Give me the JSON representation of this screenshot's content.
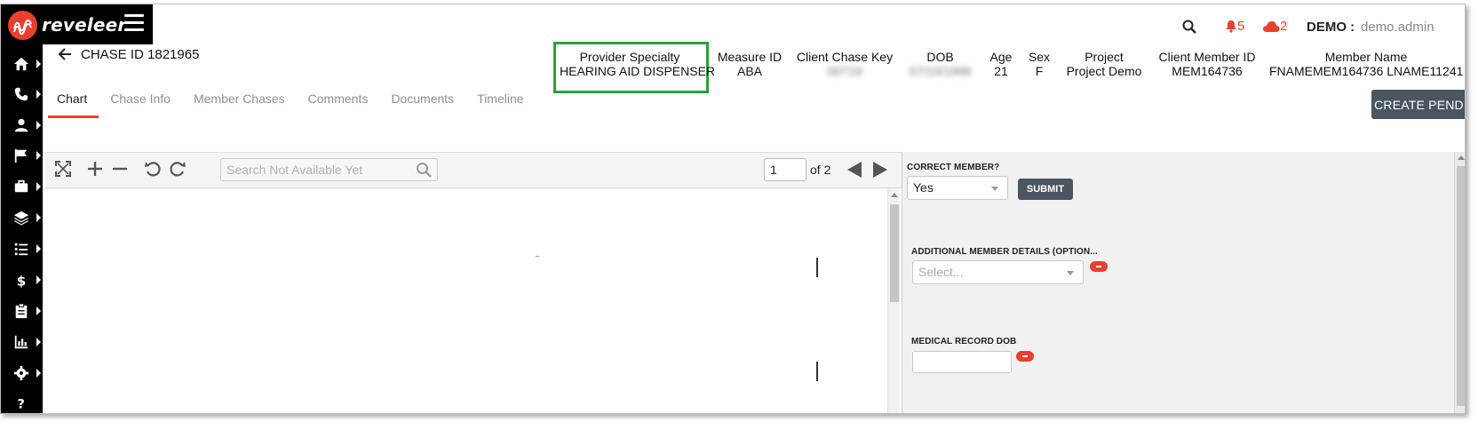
{
  "brand": {
    "name": "reveleer",
    "logo_icon": "reveleer-logo-icon",
    "menu_icon": "hamburger-menu-icon",
    "accent_color": "#e8402c"
  },
  "topbar": {
    "search_icon": "search-icon",
    "alerts_count": "5",
    "alerts_icon": "bell-icon",
    "cloud_count": "2",
    "cloud_icon": "cloud-icon",
    "user_label": "DEMO :",
    "username": "demo.admin"
  },
  "sidebar": {
    "items": [
      {
        "icon": "home-icon"
      },
      {
        "icon": "phone-icon"
      },
      {
        "icon": "user-icon"
      },
      {
        "icon": "flag-icon"
      },
      {
        "icon": "briefcase-icon"
      },
      {
        "icon": "layers-icon"
      },
      {
        "icon": "list-icon"
      },
      {
        "icon": "dollar-icon"
      },
      {
        "icon": "clipboard-icon"
      },
      {
        "icon": "bar-chart-icon"
      },
      {
        "icon": "gear-icon"
      },
      {
        "icon": "help-icon"
      }
    ]
  },
  "chase": {
    "title": "CHASE ID 1821965",
    "back_icon": "back-arrow-icon"
  },
  "meta": {
    "provider_specialty": {
      "label": "Provider Specialty",
      "value": "HEARING AID DISPENSER"
    },
    "measure_id": {
      "label": "Measure ID",
      "value": "ABA"
    },
    "client_chase_key": {
      "label": "Client Chase Key",
      "value": "00719"
    },
    "dob": {
      "label": "DOB",
      "value": "07/10/1998"
    },
    "age": {
      "label": "Age",
      "value": "21"
    },
    "sex": {
      "label": "Sex",
      "value": "F"
    },
    "project": {
      "label": "Project",
      "value": "Project Demo"
    },
    "client_member_id": {
      "label": "Client Member ID",
      "value": "MEM164736"
    },
    "member_name": {
      "label": "Member Name",
      "value": "FNAMEMEM164736 LNAME11241"
    },
    "highlight_color": "#2e9e3a"
  },
  "tabs": [
    {
      "label": "Chart",
      "active": true
    },
    {
      "label": "Chase Info"
    },
    {
      "label": "Member Chases"
    },
    {
      "label": "Comments"
    },
    {
      "label": "Documents"
    },
    {
      "label": "Timeline"
    }
  ],
  "actions": {
    "create_pend": "CREATE PEND"
  },
  "viewer": {
    "search_placeholder": "Search Not Available Yet",
    "page_value": "1",
    "page_of": "of 2",
    "tool_icons": [
      "fullscreen-icon",
      "zoom-in-icon",
      "zoom-out-icon",
      "rotate-left-icon",
      "rotate-right-icon"
    ]
  },
  "form": {
    "correct_member_label": "CORRECT MEMBER?",
    "correct_member_value": "Yes",
    "submit_label": "SUBMIT",
    "additional_details_label": "ADDITIONAL MEMBER DETAILS (OPTION...",
    "additional_details_placeholder": "Select...",
    "medical_record_dob_label": "MEDICAL RECORD DOB"
  }
}
